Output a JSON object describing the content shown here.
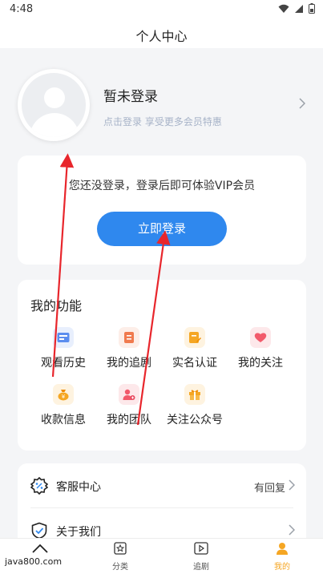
{
  "status_bar": {
    "time": "4:48"
  },
  "header": {
    "title": "个人中心"
  },
  "profile": {
    "name": "暂未登录",
    "subtitle": "点击登录 享受更多会员特惠"
  },
  "login_card": {
    "tip": "您还没登录，登录后即可体验VIP会员",
    "button_label": "立即登录"
  },
  "functions": {
    "title": "我的功能",
    "items": [
      {
        "label": "观看历史",
        "icon": "history-icon",
        "color": "#5b8def"
      },
      {
        "label": "我的追剧",
        "icon": "bookmark-list-icon",
        "color": "#f07a4e"
      },
      {
        "label": "实名认证",
        "icon": "id-card-icon",
        "color": "#f5a623"
      },
      {
        "label": "我的关注",
        "icon": "heart-icon",
        "color": "#f25a6b"
      },
      {
        "label": "收款信息",
        "icon": "money-bag-icon",
        "color": "#f5a623"
      },
      {
        "label": "我的团队",
        "icon": "team-icon",
        "color": "#f25a6b"
      },
      {
        "label": "关注公众号",
        "icon": "gift-icon",
        "color": "#f5a623"
      }
    ]
  },
  "menu": {
    "items": [
      {
        "label": "客服中心",
        "value": "有回复",
        "icon": "customer-service-icon"
      },
      {
        "label": "关于我们",
        "value": "",
        "icon": "shield-check-icon"
      }
    ]
  },
  "tabbar": {
    "items": [
      {
        "label": "",
        "icon": "home-icon"
      },
      {
        "label": "分类",
        "icon": "category-icon"
      },
      {
        "label": "追剧",
        "icon": "play-icon"
      },
      {
        "label": "我的",
        "icon": "user-icon",
        "active": true
      }
    ]
  },
  "watermark": "java800.com",
  "colors": {
    "accent": "#2f88ee",
    "active_tab": "#f5a623",
    "background": "#f4f5f7"
  }
}
